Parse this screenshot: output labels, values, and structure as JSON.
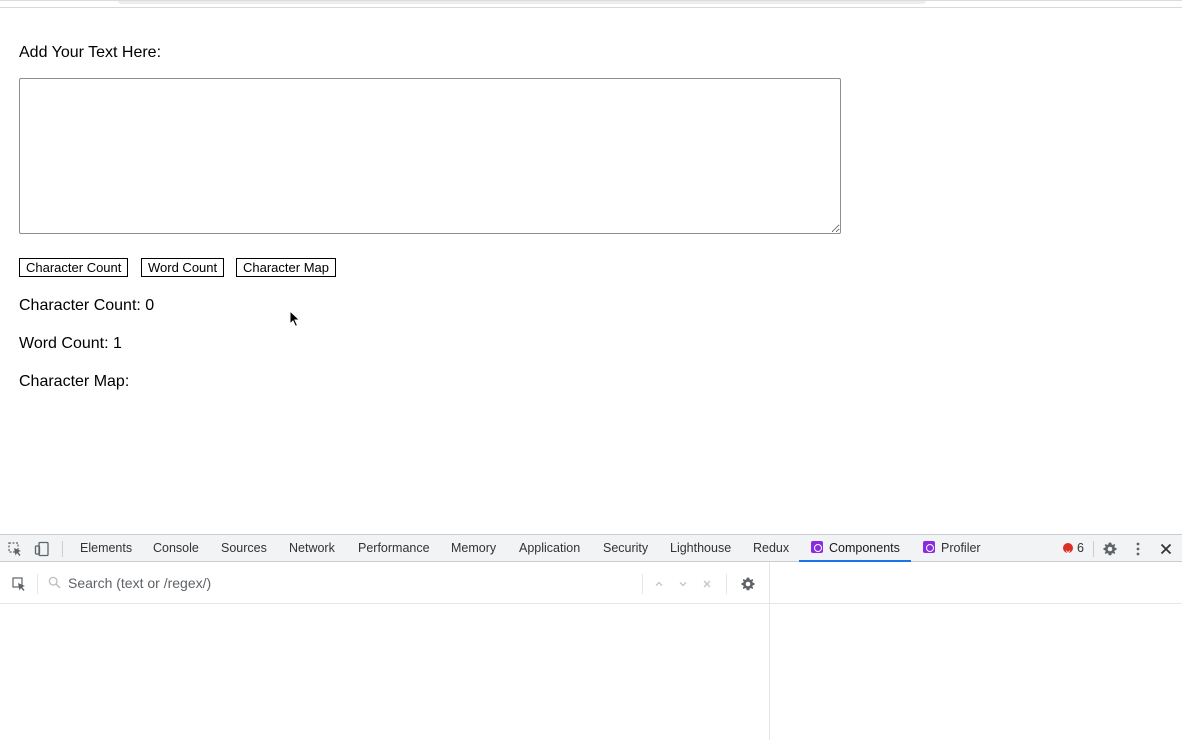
{
  "page": {
    "text_label": "Add Your Text Here:",
    "textarea_value": "",
    "buttons": {
      "character_count": "Character Count",
      "word_count": "Word Count",
      "character_map": "Character Map"
    },
    "results": {
      "character_count": "Character Count: 0",
      "word_count": "Word Count: 1",
      "character_map": "Character Map:"
    }
  },
  "devtools": {
    "tabs": [
      {
        "label": "Elements"
      },
      {
        "label": "Console"
      },
      {
        "label": "Sources"
      },
      {
        "label": "Network"
      },
      {
        "label": "Performance"
      },
      {
        "label": "Memory"
      },
      {
        "label": "Application"
      },
      {
        "label": "Security"
      },
      {
        "label": "Lighthouse"
      },
      {
        "label": "Redux"
      },
      {
        "label": "Components",
        "active": true
      },
      {
        "label": "Profiler"
      }
    ],
    "error_count": "6",
    "search_placeholder": "Search (text or /regex/)",
    "icons": [
      "inspect-element-icon",
      "device-toolbar-icon",
      "react-logo-icon",
      "error-icon",
      "settings-gear-icon",
      "more-vertical-icon",
      "close-icon",
      "search-icon",
      "arrow-up-icon",
      "arrow-down-icon",
      "clear-icon"
    ],
    "accent_color": "#1a73e8",
    "error_color": "#d93025",
    "react_badge_color": "#8a2be2"
  }
}
